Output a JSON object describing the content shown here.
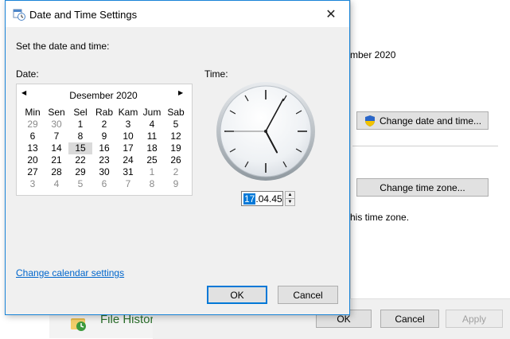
{
  "background": {
    "date_text": "mber 2020",
    "change_date_button": "Change date and time...",
    "change_timezone_button": "Change time zone...",
    "timezone_text": "his time zone.",
    "app_label": "File Histor",
    "ok_button": "OK",
    "cancel_button": "Cancel",
    "apply_button": "Apply"
  },
  "dialog": {
    "title": "Date and Time Settings",
    "close_glyph": "✕",
    "heading": "Set the date and time:",
    "date_label": "Date:",
    "time_label": "Time:",
    "calendar": {
      "prev_glyph": "◀",
      "next_glyph": "▶",
      "month_label": "Desember 2020",
      "weekdays": [
        "Min",
        "Sen",
        "Sel",
        "Rab",
        "Kam",
        "Jum",
        "Sab"
      ],
      "weeks": [
        [
          "29",
          "30",
          "1",
          "2",
          "3",
          "4",
          "5"
        ],
        [
          "6",
          "7",
          "8",
          "9",
          "10",
          "11",
          "12"
        ],
        [
          "13",
          "14",
          "15",
          "16",
          "17",
          "18",
          "19"
        ],
        [
          "20",
          "21",
          "22",
          "23",
          "24",
          "25",
          "26"
        ],
        [
          "27",
          "28",
          "29",
          "30",
          "31",
          "1",
          "2"
        ],
        [
          "3",
          "4",
          "5",
          "6",
          "7",
          "8",
          "9"
        ]
      ],
      "selected_day": "15"
    },
    "time": {
      "hour": "17",
      "rest": ".04.45",
      "hour_value": 17,
      "minute_value": 4,
      "second_value": 45
    },
    "calendar_link": "Change calendar settings",
    "ok_button": "OK",
    "cancel_button": "Cancel"
  },
  "colors": {
    "accent": "#0078d7",
    "dialog_border": "#1883d7",
    "link": "#0066cc"
  }
}
